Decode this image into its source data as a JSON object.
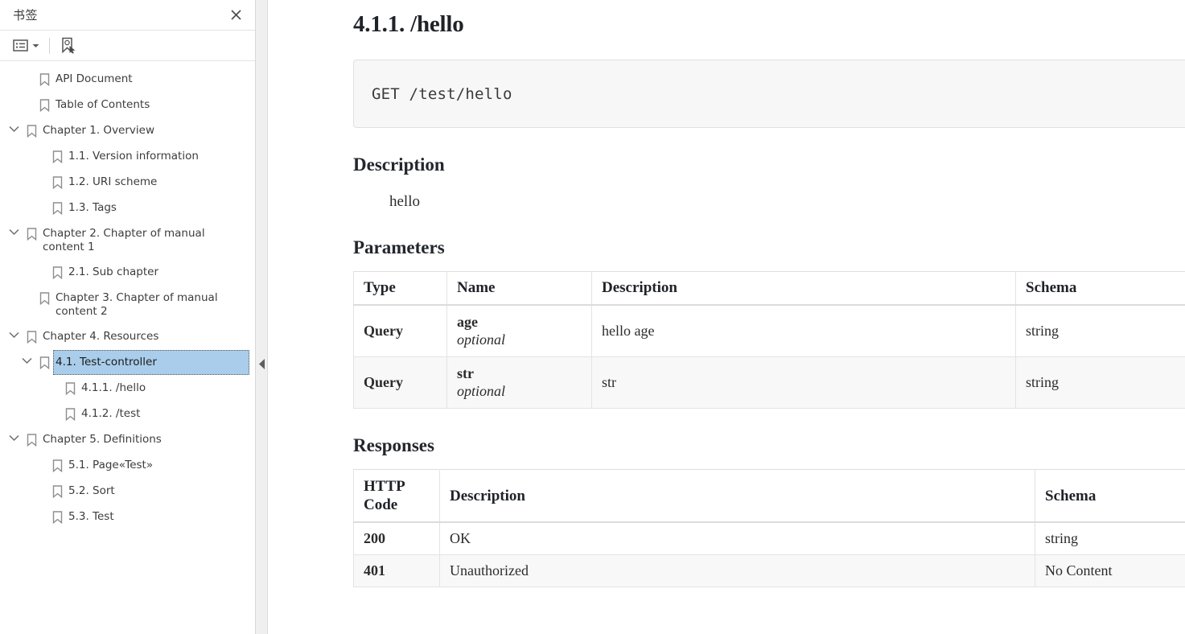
{
  "sidebar": {
    "title": "书签",
    "close_icon": "close-icon",
    "toolbar": {
      "options_label": "options-list-icon",
      "caret_label": "chevron-down-icon",
      "new_bookmark_label": "new-bookmark-icon"
    },
    "items": [
      {
        "label": "API Document",
        "level": 0,
        "expandable": false,
        "expanded": false,
        "selected": false
      },
      {
        "label": "Table of Contents",
        "level": 0,
        "expandable": false,
        "expanded": false,
        "selected": false
      },
      {
        "label": "Chapter 1. Overview",
        "level": 1,
        "expandable": true,
        "expanded": true,
        "selected": false
      },
      {
        "label": "1.1. Version information",
        "level": 2,
        "expandable": false,
        "expanded": false,
        "selected": false
      },
      {
        "label": "1.2. URI scheme",
        "level": 2,
        "expandable": false,
        "expanded": false,
        "selected": false
      },
      {
        "label": "1.3. Tags",
        "level": 2,
        "expandable": false,
        "expanded": false,
        "selected": false
      },
      {
        "label": "Chapter 2. Chapter of manual content 1",
        "level": 1,
        "expandable": true,
        "expanded": true,
        "selected": false
      },
      {
        "label": "2.1. Sub chapter",
        "level": 2,
        "expandable": false,
        "expanded": false,
        "selected": false
      },
      {
        "label": "Chapter 3. Chapter of manual content 2",
        "level": 0,
        "expandable": false,
        "expanded": false,
        "selected": false
      },
      {
        "label": "Chapter 4. Resources",
        "level": 1,
        "expandable": true,
        "expanded": true,
        "selected": false
      },
      {
        "label": "4.1. Test-controller",
        "level": 3,
        "expandable": true,
        "expanded": true,
        "selected": true
      },
      {
        "label": "4.1.1. /hello",
        "level": 4,
        "expandable": false,
        "expanded": false,
        "selected": false
      },
      {
        "label": "4.1.2. /test",
        "level": 4,
        "expandable": false,
        "expanded": false,
        "selected": false
      },
      {
        "label": "Chapter 5. Definitions",
        "level": 1,
        "expandable": true,
        "expanded": true,
        "selected": false
      },
      {
        "label": "5.1. Page«Test»",
        "level": 2,
        "expandable": false,
        "expanded": false,
        "selected": false
      },
      {
        "label": "5.2. Sort",
        "level": 2,
        "expandable": false,
        "expanded": false,
        "selected": false
      },
      {
        "label": "5.3. Test",
        "level": 2,
        "expandable": false,
        "expanded": false,
        "selected": false
      }
    ]
  },
  "splitter": {
    "handle_icon": "collapse-left-arrow-icon"
  },
  "document": {
    "section_title": "4.1.1. /hello",
    "endpoint": "GET /test/hello",
    "description_heading": "Description",
    "description_body": "hello",
    "parameters_heading": "Parameters",
    "parameters_table": {
      "headers": [
        "Type",
        "Name",
        "Description",
        "Schema"
      ],
      "rows": [
        {
          "type": "Query",
          "name": "age",
          "required": "optional",
          "description": "hello age",
          "schema": "string"
        },
        {
          "type": "Query",
          "name": "str",
          "required": "optional",
          "description": "str",
          "schema": "string"
        }
      ]
    },
    "responses_heading": "Responses",
    "responses_table": {
      "headers": [
        "HTTP Code",
        "Description",
        "Schema"
      ],
      "rows": [
        {
          "code": "200",
          "description": "OK",
          "schema": "string"
        },
        {
          "code": "401",
          "description": "Unauthorized",
          "schema": "No Content"
        }
      ]
    }
  },
  "colors": {
    "selection_blue": "#a9cdea",
    "code_bg": "#f7f7f7",
    "splitter_bg": "#efefef",
    "table_border": "#e3e3e3",
    "zebra_row": "#f8f8f8"
  }
}
